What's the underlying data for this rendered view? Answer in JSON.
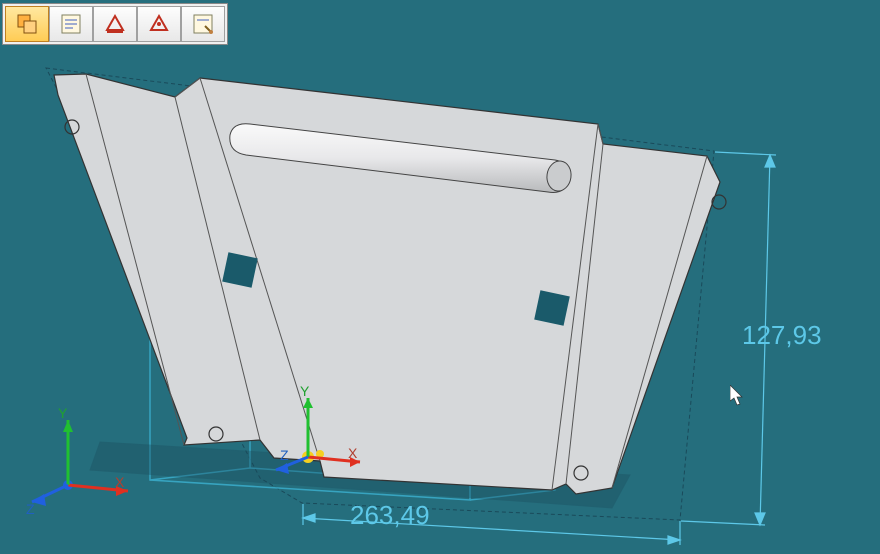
{
  "dimensions": {
    "width": "263,49",
    "height": "127,93"
  },
  "axes": {
    "main": {
      "x": "X",
      "y": "Y",
      "z": "Z"
    },
    "local": {
      "x": "X",
      "y": "Y",
      "z": "Z"
    }
  },
  "toolbar": {
    "items": [
      {
        "name": "copy-geometry-icon",
        "active": true
      },
      {
        "name": "properties-icon",
        "active": false
      },
      {
        "name": "sketch-plane-icon",
        "active": false
      },
      {
        "name": "sketch-plane-alt-icon",
        "active": false
      },
      {
        "name": "options-icon",
        "active": false
      }
    ]
  },
  "colors": {
    "dimension": "#5DC8E8",
    "selection": "#1A5A6A",
    "wireframe": "#3AAAC8",
    "part_fill": "#D6D8DA"
  }
}
